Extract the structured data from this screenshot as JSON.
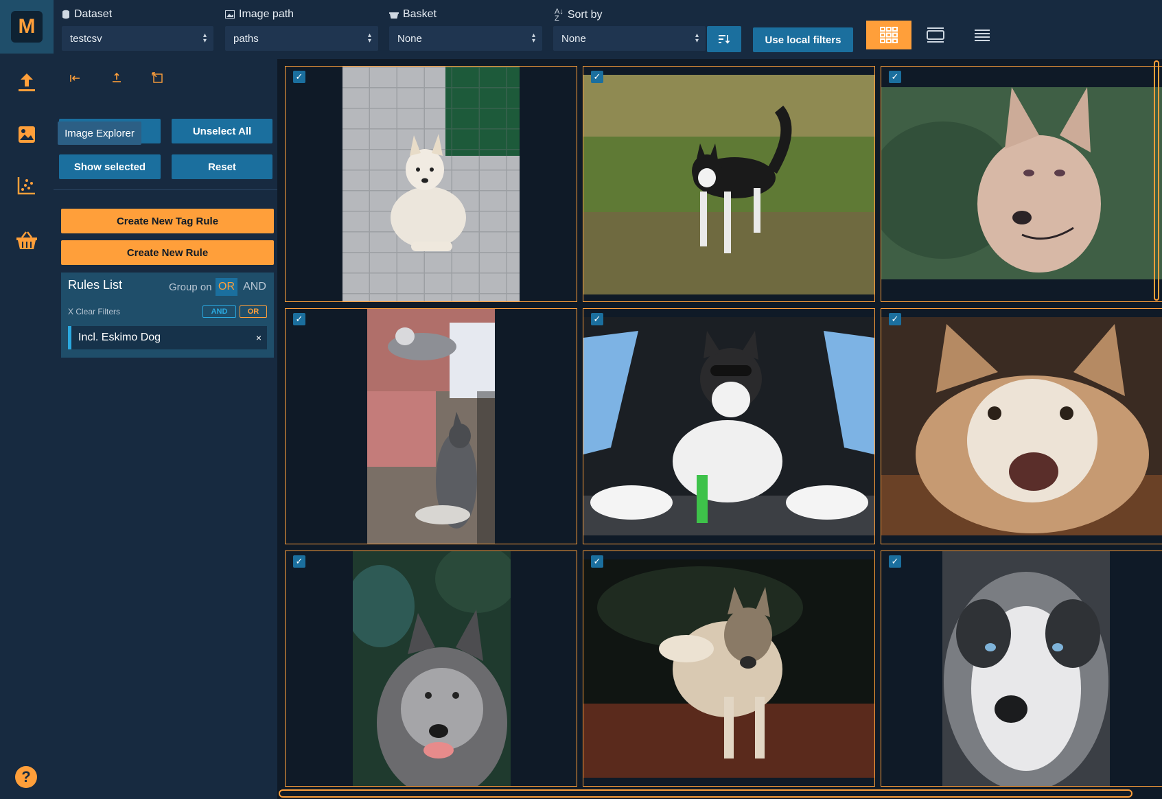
{
  "rail": {
    "logo": "M",
    "items": [
      {
        "icon": "upload-icon"
      },
      {
        "icon": "image-icon",
        "active": true
      },
      {
        "icon": "scatter-plot-icon"
      },
      {
        "icon": "basket-icon"
      }
    ],
    "help": "?"
  },
  "topbar": {
    "dataset": {
      "label": "Dataset",
      "value": "testcsv"
    },
    "image_path": {
      "label": "Image path",
      "value": "paths"
    },
    "basket": {
      "label": "Basket",
      "value": "None"
    },
    "sort_by": {
      "label": "Sort by",
      "value": "None"
    },
    "use_local_filters": "Use local filters",
    "views": [
      "grid-view-icon",
      "card-view-icon",
      "list-view-icon"
    ],
    "active_view": "grid-view-icon"
  },
  "panel": {
    "tools": [
      "collapse-icon",
      "export-icon",
      "expand-icon"
    ],
    "tooltip": "Image Explorer",
    "unselect_all": "Unselect All",
    "show_selected": "Show selected",
    "reset": "Reset",
    "create_tag_rule": "Create New Tag Rule",
    "create_rule": "Create New Rule",
    "rules": {
      "title": "Rules List",
      "group_on": "Group on",
      "or": "OR",
      "and": "AND",
      "clear_filters": "X Clear Filters",
      "mini_and": "AND",
      "mini_or": "OR",
      "items": [
        {
          "label": "Incl. Eskimo Dog",
          "remove": "×"
        }
      ]
    }
  },
  "grid": {
    "images": [
      {
        "subject": "white husky lying on stone path",
        "selected": true
      },
      {
        "subject": "black and white husky in grass",
        "selected": true
      },
      {
        "subject": "cream dog close-up",
        "selected": true
      },
      {
        "subject": "two huskies near couch",
        "selected": true
      },
      {
        "subject": "husky with sunglasses in car trunk",
        "selected": true
      },
      {
        "subject": "husky face on wood floor",
        "selected": true
      },
      {
        "subject": "grey husky in forest",
        "selected": true
      },
      {
        "subject": "husky standing in sunlight",
        "selected": true
      },
      {
        "subject": "husky portrait with blue eyes",
        "selected": true
      }
    ]
  },
  "colors": {
    "accent": "#ff9f3a",
    "primary": "#1b6f9e",
    "sidebar": "#172a40",
    "background": "#0f1a27"
  }
}
